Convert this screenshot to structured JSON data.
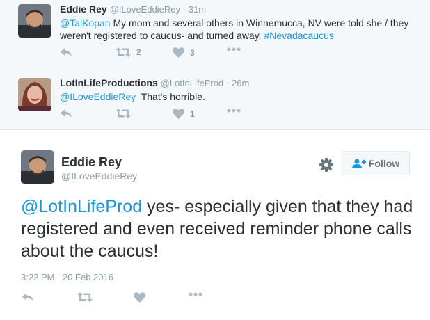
{
  "replies": [
    {
      "fullname": "Eddie Rey",
      "handle": "@ILoveEddieRey",
      "time": "· 31m",
      "mention": "@TalKopan",
      "text": " My mom and several others in Winnemucca, NV were told she / they weren't registered to caucus- and turned away. ",
      "hashtag": "#Nevadacaucus",
      "retweets": "2",
      "likes": "3"
    },
    {
      "fullname": "LotInLifeProductions",
      "handle": "@LotInLifeProd",
      "time": "· 26m",
      "mention": "@ILoveEddieRey",
      "text": "  That's horrible.",
      "retweets": "",
      "likes": "1"
    }
  ],
  "main": {
    "fullname": "Eddie Rey",
    "handle": "@ILoveEddieRey",
    "follow_label": "Follow",
    "mention": "@LotInLifeProd",
    "text": " yes- especially given that they had registered and even received reminder phone calls about the caucus!",
    "timestamp": "3:22 PM - 20 Feb 2016"
  },
  "colors": {
    "link": "#1b95e0",
    "icon": "#aab8c2",
    "secondary_text": "#8899a6",
    "reply_background": "#f5f8fa"
  },
  "icons": [
    "reply-icon",
    "retweet-icon",
    "like-icon",
    "more-icon",
    "gear-icon",
    "follow-person-icon"
  ]
}
